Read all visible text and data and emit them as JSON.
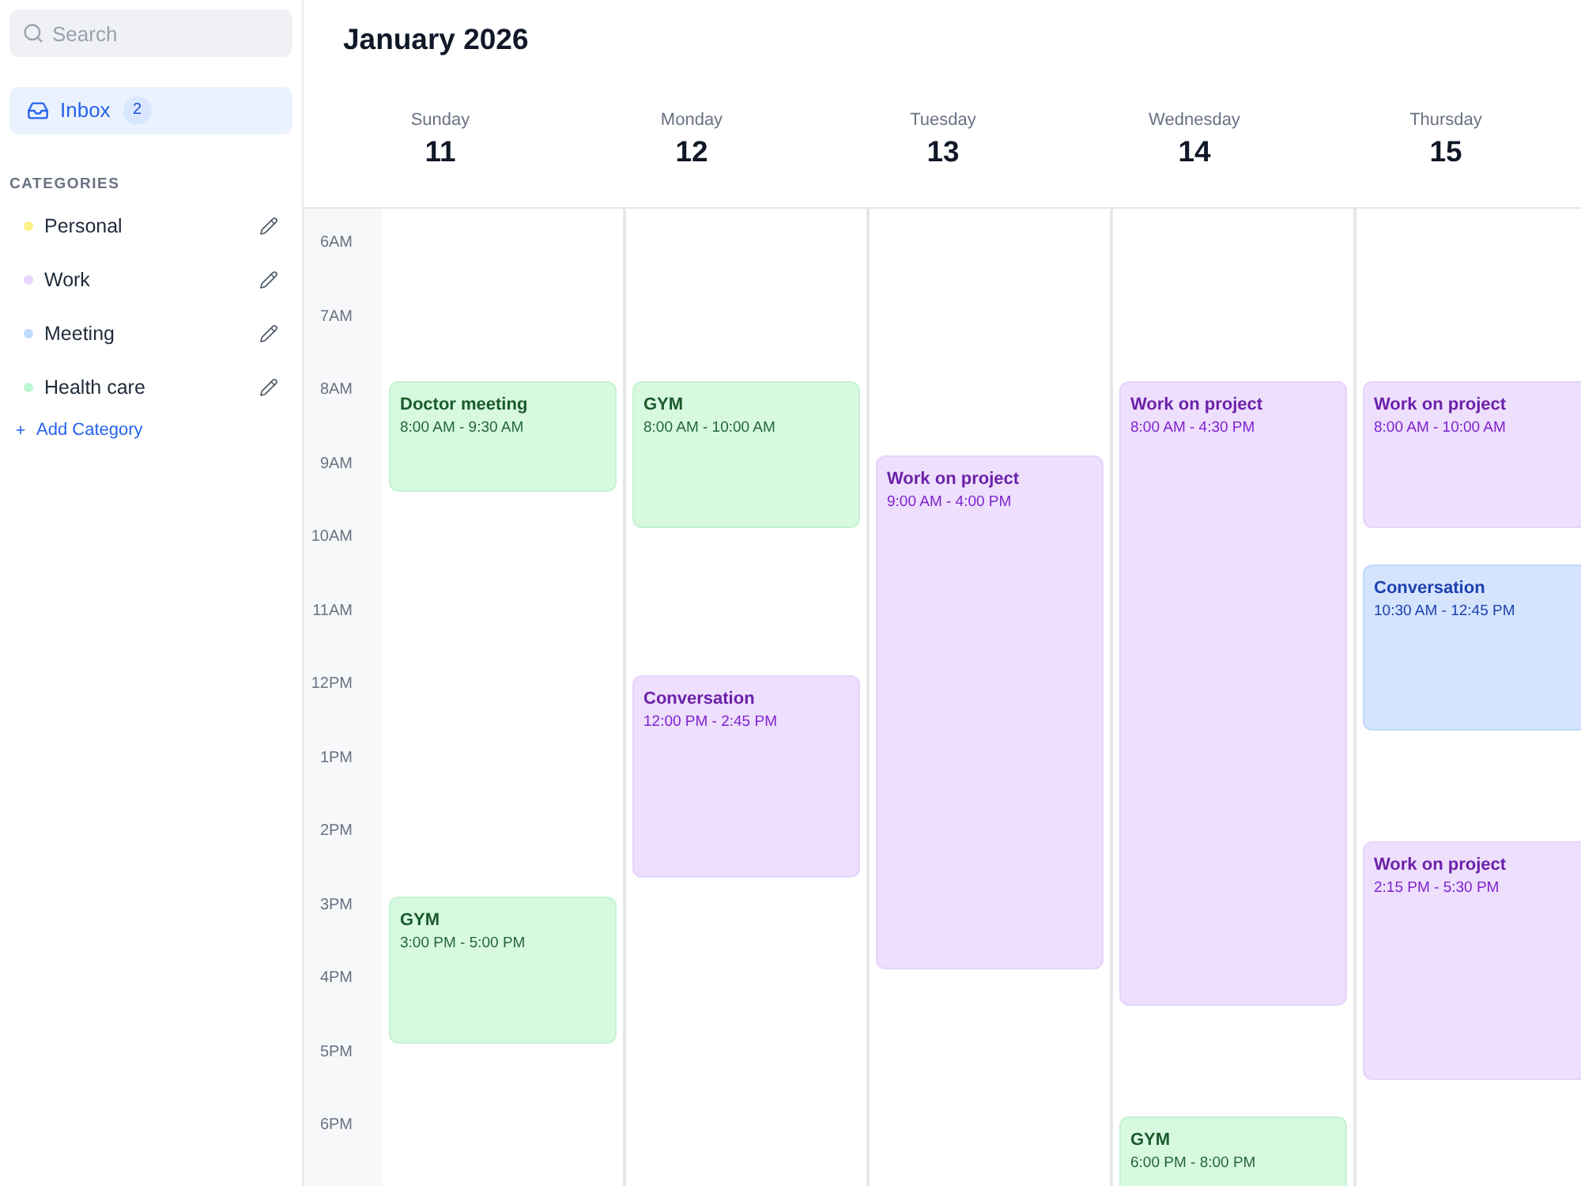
{
  "sidebar": {
    "search": {
      "placeholder": "Search"
    },
    "inbox": {
      "label": "Inbox",
      "count": "2",
      "selected": true
    },
    "categories_heading": "CATEGORIES",
    "categories": [
      {
        "name": "Personal",
        "color": "#fef08a"
      },
      {
        "name": "Work",
        "color": "#e9d5ff"
      },
      {
        "name": "Meeting",
        "color": "#bfdbfe"
      },
      {
        "name": "Health care",
        "color": "#bbf7d0"
      }
    ],
    "add_category": "Add Category"
  },
  "calendar": {
    "title": "January 2026",
    "hours": [
      "6AM",
      "7AM",
      "8AM",
      "9AM",
      "10AM",
      "11AM",
      "12PM",
      "1PM",
      "2PM",
      "3PM",
      "4PM",
      "5PM",
      "6PM"
    ],
    "days": [
      {
        "name": "Sunday",
        "date": "11",
        "events": [
          {
            "title": "Doctor meeting",
            "time": "8:00 AM - 9:30 AM",
            "kind": "health"
          },
          {
            "title": "GYM",
            "time": "3:00 PM - 5:00 PM",
            "kind": "health"
          }
        ]
      },
      {
        "name": "Monday",
        "date": "12",
        "events": [
          {
            "title": "GYM",
            "time": "8:00 AM - 10:00 AM",
            "kind": "health"
          },
          {
            "title": "Conversation",
            "time": "12:00 PM - 2:45 PM",
            "kind": "work"
          }
        ]
      },
      {
        "name": "Tuesday",
        "date": "13",
        "events": [
          {
            "title": "Work on project",
            "time": "9:00 AM - 4:00 PM",
            "kind": "work"
          }
        ]
      },
      {
        "name": "Wednesday",
        "date": "14",
        "events": [
          {
            "title": "Work on project",
            "time": "8:00 AM - 4:30 PM",
            "kind": "work"
          },
          {
            "title": "GYM",
            "time": "6:00 PM - 8:00 PM",
            "kind": "health"
          }
        ]
      },
      {
        "name": "Thursday",
        "date": "15",
        "events": [
          {
            "title": "Work on project",
            "time": "8:00 AM - 10:00 AM",
            "kind": "work"
          },
          {
            "title": "Conversation",
            "time": "10:30 AM - 12:45 PM",
            "kind": "meeting"
          },
          {
            "title": "Work on project",
            "time": "2:15 PM - 5:30 PM",
            "kind": "work"
          }
        ]
      }
    ]
  }
}
